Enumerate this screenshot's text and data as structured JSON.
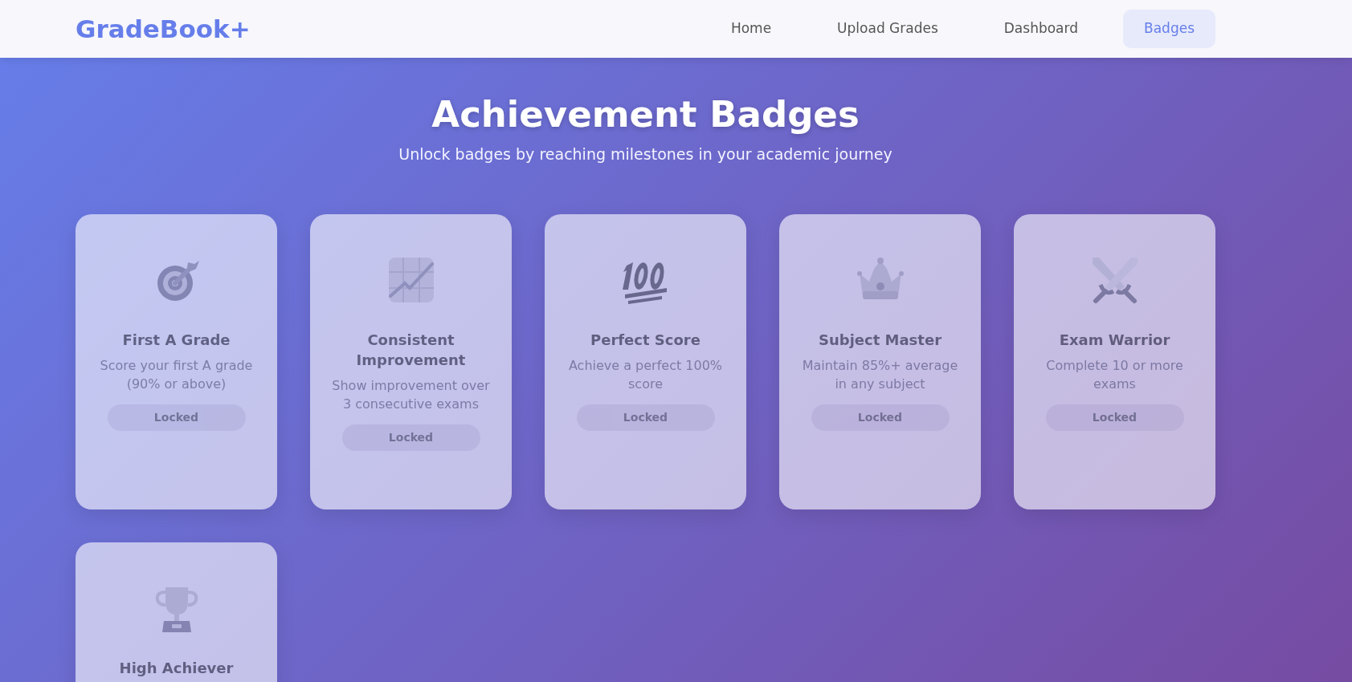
{
  "navbar": {
    "brand": "GradeBook+",
    "links": [
      {
        "label": "Home",
        "selected": false
      },
      {
        "label": "Upload Grades",
        "selected": false
      },
      {
        "label": "Dashboard",
        "selected": false
      },
      {
        "label": "Badges",
        "selected": true
      }
    ]
  },
  "header": {
    "title": "Achievement Badges",
    "subtitle": "Unlock badges by reaching milestones in your academic journey"
  },
  "badges": [
    {
      "title": "First A Grade",
      "description": "Score your first A grade (90% or above)",
      "status": "Locked",
      "locked": true
    },
    {
      "title": "Consistent Improvement",
      "description": "Show improvement over 3 consecutive exams",
      "status": "Locked",
      "locked": true
    },
    {
      "title": "Perfect Score",
      "description": "Achieve a perfect 100% score",
      "status": "Locked",
      "locked": true
    },
    {
      "title": "Subject Master",
      "description": "Maintain 85%+ average in any subject",
      "status": "Locked",
      "locked": true
    },
    {
      "title": "Exam Warrior",
      "description": "Complete 10 or more exams",
      "status": "Locked",
      "locked": true
    },
    {
      "title": "High Achiever",
      "locked": true
    }
  ]
}
